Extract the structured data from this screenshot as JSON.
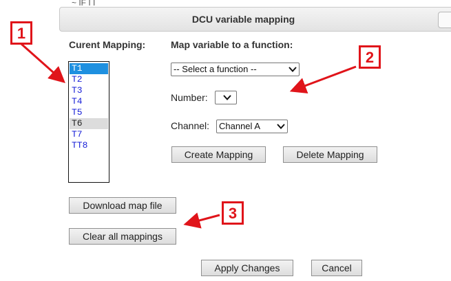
{
  "top_fragment": "~ IF I I",
  "dialog": {
    "title": "DCU variable mapping"
  },
  "current_mapping": {
    "label": "Curent Mapping:",
    "items": [
      "T1",
      "T2",
      "T3",
      "T4",
      "T5",
      "T6",
      "T7",
      "TT8"
    ],
    "selected": "T1"
  },
  "map_section": {
    "label": "Map variable to a function:",
    "function_select": "-- Select a function --",
    "number_label": "Number:",
    "number_select": "",
    "channel_label": "Channel:",
    "channel_select": "Channel A",
    "create_button": "Create Mapping",
    "delete_button": "Delete Mapping"
  },
  "file_actions": {
    "download_button": "Download map file",
    "clear_button": "Clear all mappings"
  },
  "footer": {
    "apply_button": "Apply Changes",
    "cancel_button": "Cancel"
  },
  "annotations": {
    "badge_1": "1",
    "badge_2": "2",
    "badge_3": "3",
    "color": "#e0141a"
  }
}
